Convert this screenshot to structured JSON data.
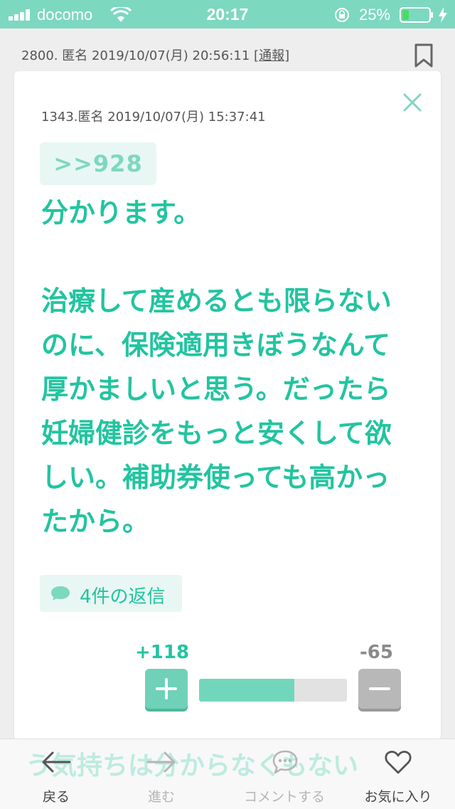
{
  "status_bar": {
    "carrier": "docomo",
    "time": "20:17",
    "battery_percent": "25%",
    "battery_level": 0.25
  },
  "post": {
    "meta": "2800. 匿名 2019/10/07(月) 20:56:11",
    "report_label": "通報"
  },
  "modal": {
    "reply_meta": "1343.匿名 2019/10/07(月) 15:37:41",
    "anchor": ">>928",
    "body_lines": [
      "分かります。",
      "",
      "治療して産めるとも限らない",
      "のに、保険適用きぼうなんて",
      "厚かましいと思う。だったら",
      "妊婦健診をもっと安くして欲",
      "しい。補助券使っても高かっ",
      "たから。"
    ],
    "replies_label": "4件の返信",
    "votes": {
      "plus_label": "+118",
      "minus_label": "-65",
      "plus": 118,
      "minus": 65
    }
  },
  "toolbar": {
    "behind_text": "う気持ちは分からなくもない",
    "back_label": "戻る",
    "forward_label": "進む",
    "comment_label": "コメントする",
    "favorite_label": "お気に入り"
  },
  "colors": {
    "accent": "#22c4a0",
    "accent_light": "#7dd8c0",
    "chip_bg": "#e8f7f3",
    "minus_gray": "#b8b8b8"
  }
}
